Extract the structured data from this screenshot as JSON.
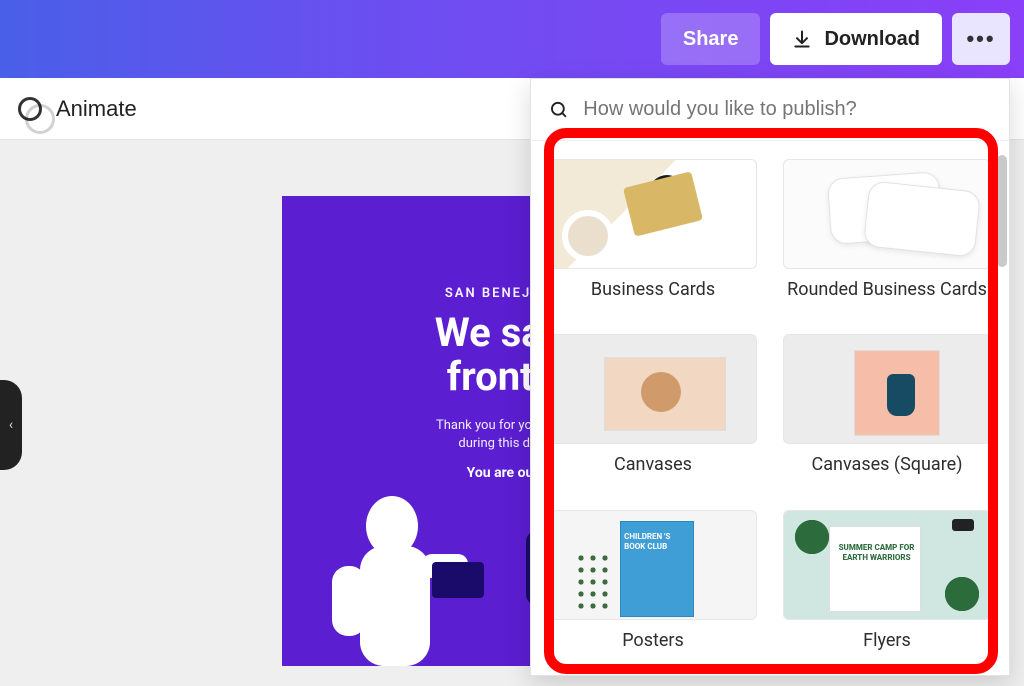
{
  "topbar": {
    "share_label": "Share",
    "download_label": "Download",
    "more_label": "•••"
  },
  "toolbar": {
    "animate_label": "Animate"
  },
  "design": {
    "eyebrow": "SAN BENEJA HOS",
    "heading_line1": "We salut",
    "heading_line2": "frontlin",
    "sub_line1": "Thank you for your service",
    "sub_line2": "during this difficult",
    "strong": "You are our he"
  },
  "publish": {
    "search_placeholder": "How would you like to publish?",
    "items": [
      {
        "id": "business-cards",
        "label": "Business Cards"
      },
      {
        "id": "rounded-business-cards",
        "label": "Rounded Business Cards"
      },
      {
        "id": "canvases",
        "label": "Canvases"
      },
      {
        "id": "canvases-square",
        "label": "Canvases (Square)"
      },
      {
        "id": "posters",
        "label": "Posters"
      },
      {
        "id": "flyers",
        "label": "Flyers"
      }
    ]
  }
}
